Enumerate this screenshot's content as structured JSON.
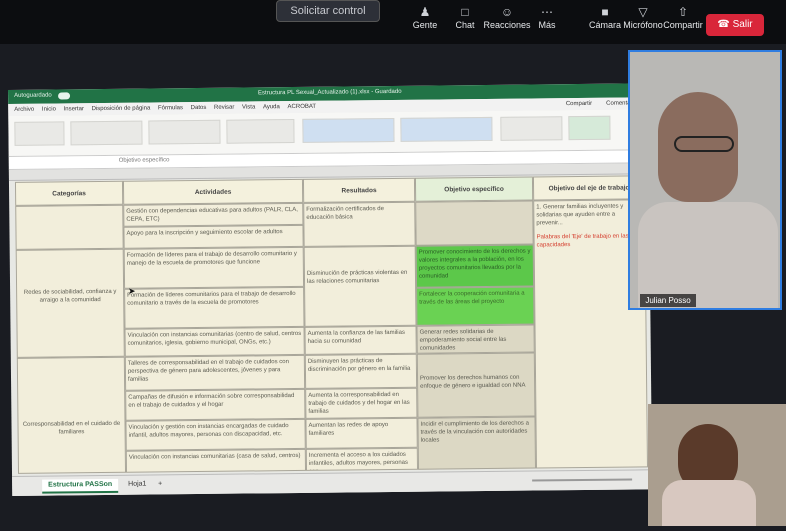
{
  "meeting": {
    "request_control": "Solicitar control",
    "top_items": [
      {
        "label": "Gente",
        "icon": "people-icon"
      },
      {
        "label": "Chat",
        "icon": "chat-icon"
      },
      {
        "label": "Reacciones",
        "icon": "reactions-icon"
      },
      {
        "label": "Más",
        "icon": "more-icon"
      },
      {
        "label": "Cámara",
        "icon": "camera-icon"
      },
      {
        "label": "Micrófono",
        "icon": "microphone-icon"
      },
      {
        "label": "Compartir",
        "icon": "share-icon"
      }
    ],
    "leave": "Salir"
  },
  "excel": {
    "autosave": "Autoguardado",
    "title": "Estructura PL Sexual_Actualizado (1).xlsx - Guardado",
    "tabs": [
      "Archivo",
      "Inicio",
      "Insertar",
      "Disposición de página",
      "Fórmulas",
      "Datos",
      "Revisar",
      "Vista",
      "Ayuda",
      "ACROBAT"
    ],
    "share": "Compartir",
    "comments": "Comentarios",
    "formula": "Objetivo específico",
    "headers": {
      "categoria": "Categorías",
      "actividades": "Actividades",
      "resultados": "Resultados",
      "objetivo": "Objetivo específico",
      "objetivo_eje": "Objetivo del eje de trabajo"
    },
    "rows": {
      "r1_act": "Gestión con dependencias educativas para adultos (PALR, CLA, CEPA, ETC)",
      "r1_res": "Formalización certificados de educación básica",
      "r1b_act": "Apoyo para la inscripción y seguimiento escolar de adultos",
      "r2_cat": "Redes de sociabilidad, confianza y arraigo a la comunidad",
      "r2_act": "Formación de líderes para el trabajo de desarrollo comunitario y manejo de la escuela de promotores que funcione",
      "r2_res": "Disminución de prácticas violentas en las relaciones comunitarias",
      "r2_obj": "Promover conocimiento de los derechos y valores integrales a la población, en los proyectos comunitarios llevados por la comunidad",
      "r2b_act": "Formación de líderes comunitarios para el trabajo de desarrollo comunitario a través de la escuela de promotores",
      "r2b_obj": "Fortalecer la cooperación comunitaria a través de las áreas del proyecto",
      "r3_act": "Vinculación con instancias comunitarias (centro de salud, centros comunitarios, iglesia, gobierno municipal, ONGs, etc.)",
      "r3_res": "Aumenta la confianza de las familias hacia su comunidad",
      "r3_obj": "Generar redes solidarias de empoderamiento social entre las comunidades",
      "r4_act": "Talleres de corresponsabilidad en el trabajo de cuidados con perspectiva de género para adolescentes, jóvenes y para familias",
      "r4_res": "Disminuyen las prácticas de discriminación por género en la familia",
      "r4_obj": "Promover los derechos humanos con enfoque de género e igualdad con NNA",
      "r4b_act": "Campañas de difusión e información sobre corresponsabilidad en el trabajo de cuidados y el hogar",
      "r4b_res": "Aumenta la corresponsabilidad en trabajo de cuidados y del hogar en las familias",
      "r5_cat": "Corresponsabilidad en el cuidado de familiares",
      "r5_act": "Vinculación y gestión con instancias encargadas de cuidado infantil, adultos mayores, personas con discapacidad, etc.",
      "r5_res": "Aumentan las redes de apoyo familiares",
      "r5_obj": "Incidir el cumplimiento de los derechos a través de la vinculación con autoridades locales",
      "r5b_act": "Vinculación con instancias comunitarias (casa de salud, centros)",
      "r5b_res": "Incrementa el acceso a los cuidados infantiles, adultos mayores, personas con...",
      "eje1": "1. Generar familias incluyentes y solidarias que ayuden entre a prevenir...",
      "eje2": "Palabras del 'Eje' de trabajo en las capacidades"
    },
    "sheet_tabs": [
      "Estructura PASSon",
      "Hoja1"
    ]
  },
  "participants": {
    "main_name": "Julian Posso"
  }
}
